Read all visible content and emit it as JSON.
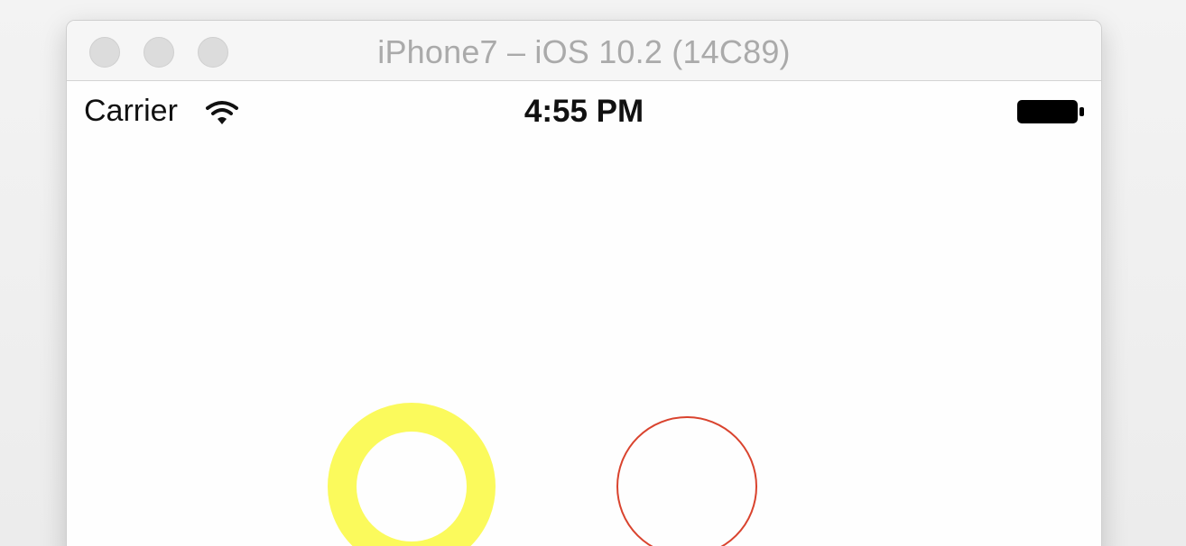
{
  "window": {
    "title": "iPhone7 – iOS 10.2 (14C89)",
    "buttons": [
      "close",
      "minimize",
      "zoom"
    ]
  },
  "statusbar": {
    "carrier": "Carrier",
    "time": "4:55 PM",
    "wifi_icon": "wifi-icon",
    "battery_icon": "battery-icon"
  },
  "content": {
    "shapes": [
      {
        "name": "yellow-ring",
        "color": "#fbfa5c",
        "style": "thick ring"
      },
      {
        "name": "red-ring",
        "color": "#d9432e",
        "style": "thin circle outline"
      }
    ]
  },
  "colors": {
    "ring_yellow": "#fbfa5c",
    "ring_red": "#d9432e",
    "traffic_light": "#dcdcdc"
  }
}
